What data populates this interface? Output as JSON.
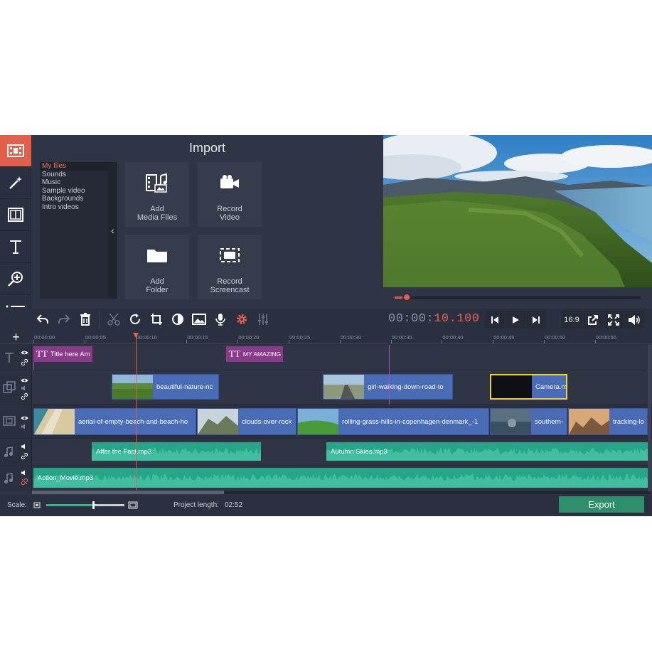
{
  "import": {
    "title": "Import",
    "file_categories": [
      "My files",
      "Sounds",
      "Music",
      "Sample video",
      "Backgrounds",
      "Intro videos"
    ],
    "tiles": {
      "add_media": "Add\nMedia Files",
      "record_video": "Record\nVideo",
      "add_folder": "Add\nFolder",
      "record_screencast": "Record\nScreencast"
    }
  },
  "player": {
    "timecode_dim": "00:00:",
    "timecode_hi": "10.100",
    "progress": 0.05,
    "aspect": "16:9"
  },
  "ruler": {
    "ticks": [
      "00:00:00",
      "00:00:05",
      "00:00:10",
      "00:00:15",
      "00:00:20",
      "00:00:25",
      "00:00:30",
      "00:00:35",
      "00:00:40",
      "00:00:45",
      "00:00:50",
      "00:00:55"
    ]
  },
  "tracks": {
    "titles": [
      "Title here Am",
      "MY AMAZING"
    ],
    "overlay": [
      "beautiful-nature-nc",
      "girl-walking-down-road-to",
      "Camera.m"
    ],
    "main": [
      "aerial-of-empty-beach-and-beach-ho",
      "clouds-over-rock",
      "rolling-grass-hills-in-copenhagen-denmark_-1",
      "southern-",
      "tracking-lo"
    ],
    "audio1": [
      "After the Fact.mp3",
      "Autumn Skies.mp3"
    ],
    "audio2": [
      "Action_Movie.mp3"
    ]
  },
  "bottom": {
    "scale_label": "Scale:",
    "scale_value": 0.5,
    "project_length_label": "Project length:",
    "project_length": "02:52",
    "export_label": "Export"
  },
  "colors": {
    "accent": "#e2604a",
    "video_clip": "#4a6bb5",
    "title_clip": "#8a3a8a",
    "audio_clip": "#27a589",
    "export": "#2e8f6b"
  }
}
